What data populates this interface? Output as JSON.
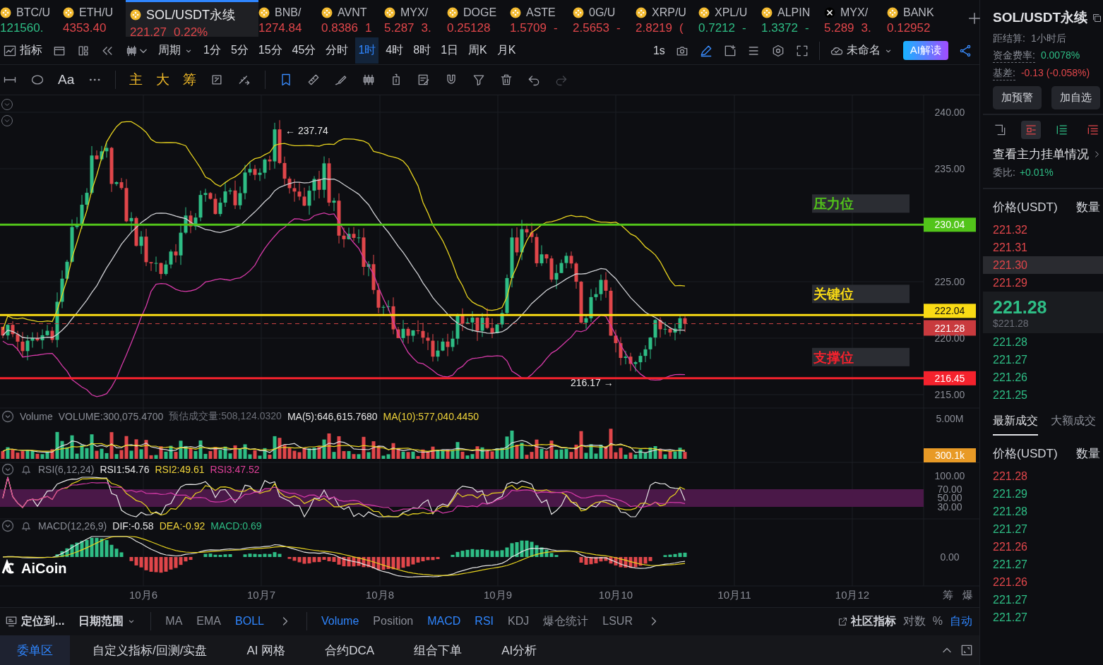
{
  "tickers": [
    {
      "symbol": "BTC/U",
      "price": "121560.",
      "rising": true,
      "kind": "coin",
      "selected": false
    },
    {
      "symbol": "ETH/U",
      "price": "4353.40",
      "rising": false,
      "kind": "coin",
      "selected": false
    },
    {
      "symbol": "SOL/USDT永续",
      "price": "221.27",
      "change": "0.22%",
      "rising": false,
      "kind": "coin",
      "selected": true
    },
    {
      "symbol": "BNB/",
      "price": "1274.84",
      "rising": false,
      "kind": "coin",
      "selected": false
    },
    {
      "symbol": "AVNT",
      "price": "0.8386",
      "change": "1",
      "rising": false,
      "kind": "coin",
      "selected": false
    },
    {
      "symbol": "MYX/",
      "price": "5.287",
      "change": "3.",
      "rising": false,
      "kind": "coin",
      "selected": false
    },
    {
      "symbol": "DOGE",
      "price": "0.25128",
      "rising": false,
      "kind": "coin",
      "selected": false
    },
    {
      "symbol": "ASTE",
      "price": "1.5709",
      "change": "-",
      "rising": false,
      "kind": "coin",
      "selected": false
    },
    {
      "symbol": "0G/U",
      "price": "2.5653",
      "change": "-",
      "rising": false,
      "kind": "coin",
      "selected": false
    },
    {
      "symbol": "XRP/U",
      "price": "2.8219",
      "change": "(",
      "rising": false,
      "kind": "coin",
      "selected": false
    },
    {
      "symbol": "XPL/U",
      "price": "0.7212",
      "change": "-",
      "rising": true,
      "kind": "coin",
      "selected": false
    },
    {
      "symbol": "ALPIN",
      "price": "1.3372",
      "change": "-",
      "rising": true,
      "kind": "coin",
      "selected": false
    },
    {
      "symbol": "MYX/",
      "price": "5.289",
      "change": "3.",
      "rising": false,
      "kind": "cross",
      "selected": false
    },
    {
      "symbol": "BANK",
      "price": "0.12952",
      "rising": false,
      "kind": "coin",
      "selected": false
    }
  ],
  "toolbar": {
    "indicators_label": "指标",
    "period_label": "周期",
    "intervals": [
      {
        "label": "1分",
        "selected": false
      },
      {
        "label": "5分",
        "selected": false
      },
      {
        "label": "15分",
        "selected": false
      },
      {
        "label": "45分",
        "selected": false
      },
      {
        "label": "分时",
        "selected": false
      },
      {
        "label": "1时",
        "selected": true
      },
      {
        "label": "4时",
        "selected": false
      },
      {
        "label": "8时",
        "selected": false
      },
      {
        "label": "1日",
        "selected": false
      },
      {
        "label": "周K",
        "selected": false
      },
      {
        "label": "月K",
        "selected": false
      }
    ],
    "refresh": "1s",
    "layout_name": "未命名",
    "ai_button": "AI解读"
  },
  "draw_tools": {
    "text_tool": "Aa",
    "overlays": [
      "主",
      "大",
      "筹"
    ]
  },
  "chart": {
    "price_ticks": [
      "240.00",
      "235.00",
      "225.00",
      "220.00",
      "215.00"
    ],
    "levels": [
      {
        "label": "压力位",
        "price": "230.04",
        "color": "#52c41a"
      },
      {
        "label": "关键位",
        "price": "222.04",
        "color": "#fadb14"
      },
      {
        "label": "支撑位",
        "price": "216.45",
        "color": "#f5222d"
      }
    ],
    "current_price": "221.28",
    "high_marker": "← 237.74",
    "low_marker": "216.17 →",
    "volume": {
      "legend": [
        {
          "text": "Volume",
          "color": "#8a8d96"
        },
        {
          "text": "VOLUME:300,075.4700",
          "color": "#8a8d96"
        },
        {
          "text": "预估成交量:508,124.0320",
          "color": "#6b6e77"
        },
        {
          "text": "MA(5):646,615.7680",
          "color": "#e6e6e6"
        },
        {
          "text": "MA(10):577,040.4450",
          "color": "#f0d43a"
        }
      ],
      "tick": "5.00M",
      "tag": "300.1k"
    },
    "rsi": {
      "legend": [
        {
          "text": "RSI(6,12,24)",
          "color": "#8a8d96"
        },
        {
          "text": "RSI1:54.76",
          "color": "#e6e6e6"
        },
        {
          "text": "RSI2:49.61",
          "color": "#f0d43a"
        },
        {
          "text": "RSI3:47.52",
          "color": "#e0409a"
        }
      ],
      "ticks": [
        "100.00",
        "70.00",
        "50.00",
        "30.00"
      ]
    },
    "macd": {
      "legend": [
        {
          "text": "MACD(12,26,9)",
          "color": "#8a8d96"
        },
        {
          "text": "DIF:-0.58",
          "color": "#e6e6e6"
        },
        {
          "text": "DEA:-0.92",
          "color": "#f0d43a"
        },
        {
          "text": "MACD:0.69",
          "color": "#2ebd85"
        }
      ],
      "tick": "0.00"
    },
    "logo": "AiCoin",
    "dates": [
      "10月6",
      "10月7",
      "10月8",
      "10月9",
      "10月10",
      "10月11",
      "10月12"
    ],
    "axis_extras": [
      "筹",
      "爆"
    ]
  },
  "bottom_toolbar": {
    "locate": "定位到...",
    "date_range": "日期范围",
    "main_indicators": [
      {
        "label": "MA",
        "selected": false
      },
      {
        "label": "EMA",
        "selected": false
      },
      {
        "label": "BOLL",
        "selected": true
      }
    ],
    "sub_indicators": [
      {
        "label": "Volume",
        "selected": true
      },
      {
        "label": "Position",
        "selected": false
      },
      {
        "label": "MACD",
        "selected": true
      },
      {
        "label": "RSI",
        "selected": true
      },
      {
        "label": "KDJ",
        "selected": false
      },
      {
        "label": "爆仓统计",
        "selected": false
      },
      {
        "label": "LSUR",
        "selected": false
      }
    ],
    "community": "社区指标",
    "scale_options": [
      {
        "label": "对数",
        "selected": false
      },
      {
        "label": "%",
        "selected": false
      },
      {
        "label": "自动",
        "selected": true
      }
    ]
  },
  "bottom_tabs": [
    {
      "label": "委单区",
      "selected": true
    },
    {
      "label": "自定义指标/回测/实盘",
      "selected": false
    },
    {
      "label": "AI 网格",
      "selected": false
    },
    {
      "label": "合约DCA",
      "selected": false
    },
    {
      "label": "组合下单",
      "selected": false
    },
    {
      "label": "AI分析",
      "selected": false
    }
  ],
  "side": {
    "title": "SOL/USDT永续",
    "stats": [
      {
        "label": "距结算:",
        "value": "1小时后",
        "kind": "plain"
      },
      {
        "label": "资金费率:",
        "value": "0.0078%",
        "kind": "up"
      },
      {
        "label": "基差:",
        "value": "-0.13 (-0.058%)",
        "kind": "down"
      }
    ],
    "buttons": [
      "加预警",
      "加自选"
    ],
    "view_tabs": [
      {
        "selected": false
      },
      {
        "selected": true
      },
      {
        "selected": false
      },
      {
        "selected": false
      }
    ],
    "depth_link": "查看主力挂单情况",
    "ratio_label": "委比:",
    "ratio": "+0.01%",
    "book_headers": [
      "价格(USDT)",
      "数量"
    ],
    "asks": [
      {
        "price": "221.32",
        "highlighted": false
      },
      {
        "price": "221.31",
        "highlighted": false
      },
      {
        "price": "221.30",
        "highlighted": true
      },
      {
        "price": "221.29",
        "highlighted": false
      }
    ],
    "last_price": "221.28",
    "last_price_usd": "$221.28",
    "bids": [
      {
        "price": "221.28"
      },
      {
        "price": "221.27"
      },
      {
        "price": "221.26"
      },
      {
        "price": "221.25"
      }
    ],
    "trade_tabs": [
      {
        "label": "最新成交",
        "selected": true
      },
      {
        "label": "大额成交",
        "selected": false
      }
    ],
    "trade_headers": [
      "价格(USDT)",
      "数量"
    ],
    "trades": [
      {
        "price": "221.28",
        "rising": false
      },
      {
        "price": "221.29",
        "rising": true
      },
      {
        "price": "221.28",
        "rising": true
      },
      {
        "price": "221.27",
        "rising": true
      },
      {
        "price": "221.26",
        "rising": false
      },
      {
        "price": "221.27",
        "rising": true
      },
      {
        "price": "221.26",
        "rising": false
      },
      {
        "price": "221.27",
        "rising": true
      },
      {
        "price": "221.27",
        "rising": true
      }
    ]
  }
}
